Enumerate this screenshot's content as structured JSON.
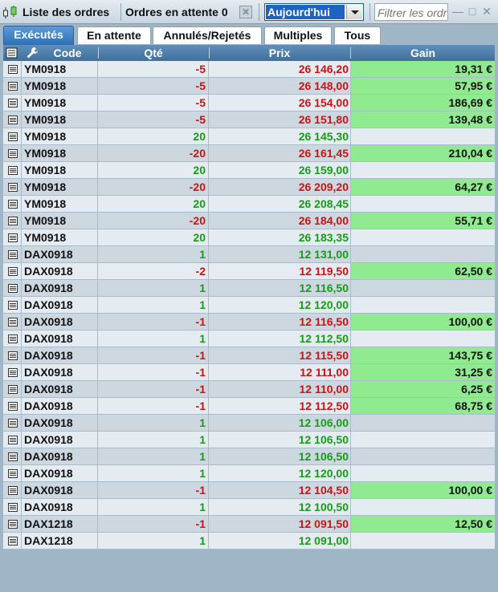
{
  "toolbar": {
    "title": "Liste des ordres",
    "pending_label": "Ordres en attente 0",
    "clear_icon": "close-icon",
    "period_value": "Aujourd'hui",
    "filter_placeholder": "Filtrer les ordres",
    "window_buttons": [
      "—",
      "□",
      "✕"
    ]
  },
  "tabs": [
    {
      "label": "Exécutés",
      "active": true
    },
    {
      "label": "En attente",
      "active": false
    },
    {
      "label": "Annulés/Rejetés",
      "active": false
    },
    {
      "label": "Multiples",
      "active": false
    },
    {
      "label": "Tous",
      "active": false
    }
  ],
  "columns": {
    "code": "Code",
    "qty": "Qté",
    "price": "Prix",
    "gain": "Gain"
  },
  "colors": {
    "positive": "#1a9a1a",
    "negative": "#c81414",
    "gain_bg": "#90ea90",
    "accent": "#2d6fb8"
  },
  "rows": [
    {
      "code": "YM0918",
      "qty": "-5",
      "price": "26 146,20",
      "gain": "19,31 €"
    },
    {
      "code": "YM0918",
      "qty": "-5",
      "price": "26 148,00",
      "gain": "57,95 €"
    },
    {
      "code": "YM0918",
      "qty": "-5",
      "price": "26 154,00",
      "gain": "186,69 €"
    },
    {
      "code": "YM0918",
      "qty": "-5",
      "price": "26 151,80",
      "gain": "139,48 €"
    },
    {
      "code": "YM0918",
      "qty": "20",
      "price": "26 145,30",
      "gain": ""
    },
    {
      "code": "YM0918",
      "qty": "-20",
      "price": "26 161,45",
      "gain": "210,04 €"
    },
    {
      "code": "YM0918",
      "qty": "20",
      "price": "26 159,00",
      "gain": ""
    },
    {
      "code": "YM0918",
      "qty": "-20",
      "price": "26 209,20",
      "gain": "64,27 €"
    },
    {
      "code": "YM0918",
      "qty": "20",
      "price": "26 208,45",
      "gain": ""
    },
    {
      "code": "YM0918",
      "qty": "-20",
      "price": "26 184,00",
      "gain": "55,71 €"
    },
    {
      "code": "YM0918",
      "qty": "20",
      "price": "26 183,35",
      "gain": ""
    },
    {
      "code": "DAX0918",
      "qty": "1",
      "price": "12 131,00",
      "gain": ""
    },
    {
      "code": "DAX0918",
      "qty": "-2",
      "price": "12 119,50",
      "gain": "62,50 €"
    },
    {
      "code": "DAX0918",
      "qty": "1",
      "price": "12 116,50",
      "gain": ""
    },
    {
      "code": "DAX0918",
      "qty": "1",
      "price": "12 120,00",
      "gain": ""
    },
    {
      "code": "DAX0918",
      "qty": "-1",
      "price": "12 116,50",
      "gain": "100,00 €"
    },
    {
      "code": "DAX0918",
      "qty": "1",
      "price": "12 112,50",
      "gain": ""
    },
    {
      "code": "DAX0918",
      "qty": "-1",
      "price": "12 115,50",
      "gain": "143,75 €"
    },
    {
      "code": "DAX0918",
      "qty": "-1",
      "price": "12 111,00",
      "gain": "31,25 €"
    },
    {
      "code": "DAX0918",
      "qty": "-1",
      "price": "12 110,00",
      "gain": "6,25 €"
    },
    {
      "code": "DAX0918",
      "qty": "-1",
      "price": "12 112,50",
      "gain": "68,75 €"
    },
    {
      "code": "DAX0918",
      "qty": "1",
      "price": "12 106,00",
      "gain": ""
    },
    {
      "code": "DAX0918",
      "qty": "1",
      "price": "12 106,50",
      "gain": ""
    },
    {
      "code": "DAX0918",
      "qty": "1",
      "price": "12 106,50",
      "gain": ""
    },
    {
      "code": "DAX0918",
      "qty": "1",
      "price": "12 120,00",
      "gain": ""
    },
    {
      "code": "DAX0918",
      "qty": "-1",
      "price": "12 104,50",
      "gain": "100,00 €"
    },
    {
      "code": "DAX0918",
      "qty": "1",
      "price": "12 100,50",
      "gain": ""
    },
    {
      "code": "DAX1218",
      "qty": "-1",
      "price": "12 091,50",
      "gain": "12,50 €"
    },
    {
      "code": "DAX1218",
      "qty": "1",
      "price": "12 091,00",
      "gain": ""
    }
  ]
}
